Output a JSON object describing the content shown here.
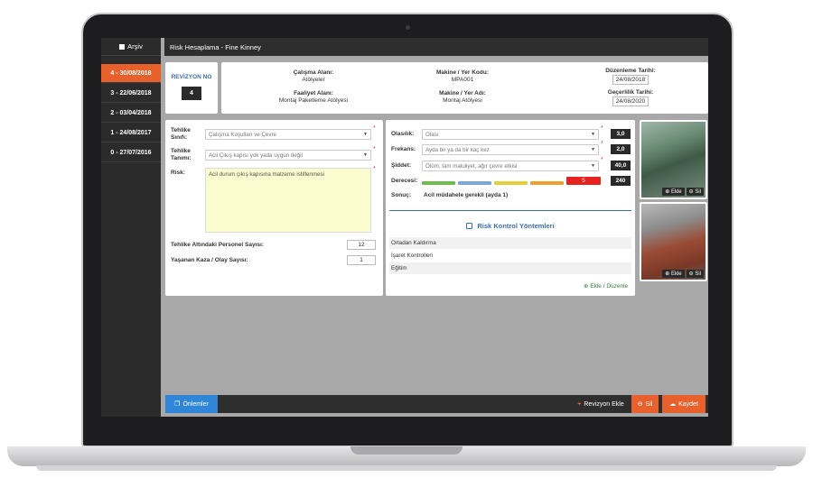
{
  "sidebar": {
    "title": "Arşiv",
    "items": [
      {
        "label": "4 - 30/08/2018"
      },
      {
        "label": "3 - 22/06/2018"
      },
      {
        "label": "2 - 03/04/2018"
      },
      {
        "label": "1 - 24/08/2017"
      },
      {
        "label": "0 - 27/07/2016"
      }
    ]
  },
  "header": {
    "title": "Risk Hesaplama - Fine Kinney"
  },
  "revision": {
    "label": "REVİZYON NO",
    "number": "4"
  },
  "info": {
    "work_area_label": "Çalışma Alanı:",
    "work_area": "Atölyeler",
    "activity_area_label": "Faaliyet Alanı:",
    "activity_area": "Montaj Paketleme Atölyesi",
    "machine_code_label": "Makine / Yer Kodu:",
    "machine_code": "MPA001",
    "machine_name_label": "Makine / Yer Adı:",
    "machine_name": "Montaj Atölyesi",
    "edit_date_label": "Düzenleme Tarihi:",
    "edit_date": "24/08/2018",
    "valid_date_label": "Geçerlilik Tarihi:",
    "valid_date": "24/08/2020"
  },
  "form": {
    "hazard_class_label": "Tehlike Sınıfı:",
    "hazard_class": "Çalışma Koşulları ve Çevre",
    "hazard_def_label": "Tehlike Tanımı:",
    "hazard_def": "Acil Çıkış kapısı yok yada uygun değil",
    "risk_label": "Risk:",
    "risk_text": "Acil durum çıkış kapısına malzeme istiflenmesi",
    "personnel_label": "Tehlike Altındaki Personel Sayısı:",
    "personnel": "12",
    "accident_label": "Yaşanan Kaza / Olay Sayısı:",
    "accident": "1"
  },
  "assessment": {
    "prob_label": "Olasılık:",
    "prob": "Olası",
    "prob_val": "3,0",
    "freq_label": "Frekans:",
    "freq": "Ayda bir ya da bir kaç kez",
    "freq_val": "2,0",
    "sev_label": "Şiddet:",
    "sev": "Ölüm, tam maluliyet, ağır çevre etkisi",
    "sev_val": "40,0",
    "degree_label": "Derecesi:",
    "degree_level": "5",
    "degree_val": "240",
    "result_label": "Sonuç:",
    "result": "Acil müdahele gerekli (ayda 1)",
    "scale_colors": [
      "#6cbf4a",
      "#7fa6d8",
      "#e4cf3a",
      "#f0a12d",
      "#e8231f"
    ]
  },
  "controls": {
    "title": "Risk Kontrol Yöntemleri",
    "rows": [
      "Ortadan Kaldırma",
      "İşaret Kontrolleri",
      "Eğitim"
    ],
    "edit_label": "Ekle / Düzenle"
  },
  "photos": {
    "add_label": "Ekle",
    "delete_label": "Sil"
  },
  "footer": {
    "measures_label": "Önlemler",
    "add_revision_label": "Revizyon Ekle",
    "delete_label": "Sil",
    "save_label": "Kaydet"
  }
}
